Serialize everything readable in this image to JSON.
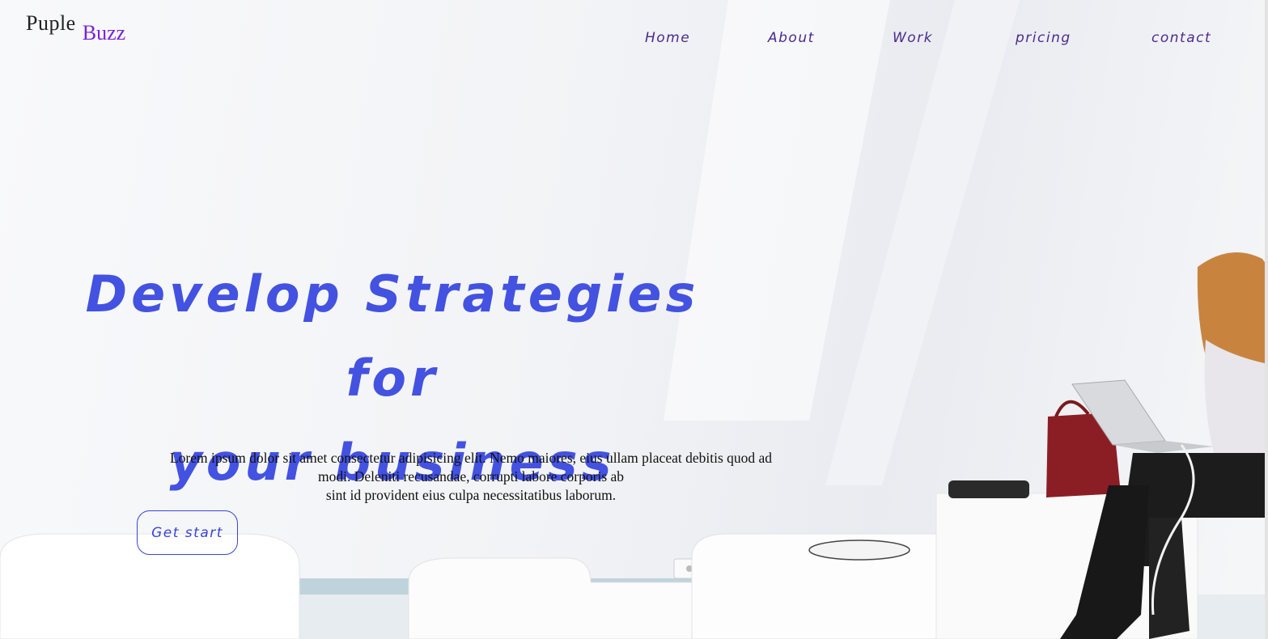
{
  "brand": {
    "word1": "Puple",
    "word2": "Buzz"
  },
  "nav": {
    "items": [
      "Home",
      "About",
      "Work",
      "pricing",
      "contact"
    ]
  },
  "hero": {
    "title_line1": "Develop Strategies for",
    "title_line2": "your business",
    "body_line1": "Lorem ipsum dolor sit amet consectetur adipisicing elit. Nemo maiores, eius ullam placeat debitis quod ad",
    "body_line2": "modi. Deleniti recusandae, corrupti labore corporis ab",
    "body_line3": "sint id provident eius culpa necessitatibus laborum.",
    "cta_label": "Get start"
  },
  "colors": {
    "accent": "#4352e0",
    "brand_purple": "#7b22d8",
    "nav_text": "#4b2a8e"
  }
}
